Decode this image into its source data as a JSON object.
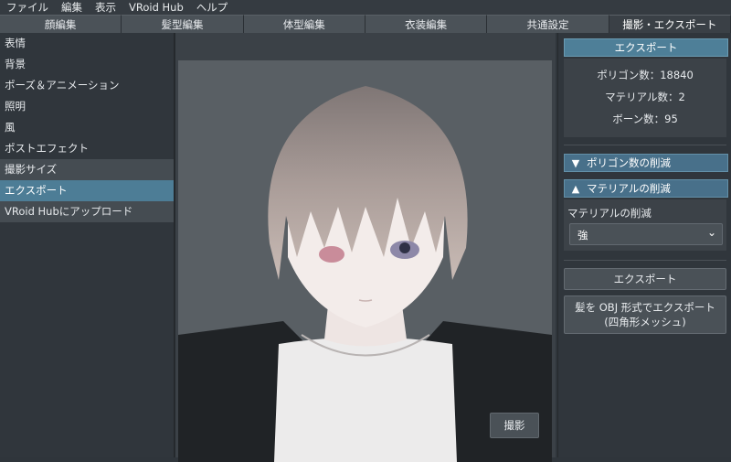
{
  "menu": [
    "ファイル",
    "編集",
    "表示",
    "VRoid Hub",
    "ヘルプ"
  ],
  "tabs": [
    "顔編集",
    "髪型編集",
    "体型編集",
    "衣装編集",
    "共通設定",
    "撮影・エクスポート"
  ],
  "left_items": [
    "表情",
    "背景",
    "ポーズ＆アニメーション",
    "照明",
    "風",
    "ポストエフェクト",
    "撮影サイズ",
    "エクスポート",
    "VRoid Hubにアップロード"
  ],
  "viewport": {
    "shoot_button": "撮影"
  },
  "right": {
    "header": "エクスポート",
    "stats": {
      "polygons": "ポリゴン数：18840",
      "materials": "マテリアル数：2",
      "bones": "ボーン数：95"
    },
    "polygon_reduction": "ポリゴン数の削減",
    "material_reduction": "マテリアルの削減",
    "material_reduction_label": "マテリアルの削減",
    "material_reduction_value": "強",
    "export_button": "エクスポート",
    "obj_button_line1": "髪を OBJ 形式でエクスポート",
    "obj_button_line2": "(四角形メッシュ)"
  }
}
